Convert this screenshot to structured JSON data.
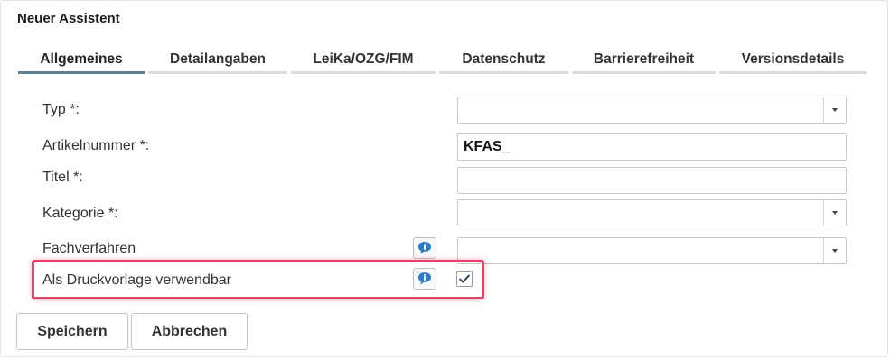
{
  "dialog": {
    "title": "Neuer Assistent"
  },
  "tabs": [
    {
      "label": "Allgemeines",
      "active": true
    },
    {
      "label": "Detailangaben",
      "active": false
    },
    {
      "label": "LeiKa/OZG/FIM",
      "active": false
    },
    {
      "label": "Datenschutz",
      "active": false
    },
    {
      "label": "Barrierefreiheit",
      "active": false
    },
    {
      "label": "Versionsdetails",
      "active": false
    }
  ],
  "form": {
    "typ": {
      "label": "Typ *:",
      "value": ""
    },
    "artikelnummer": {
      "label": "Artikelnummer *:",
      "value": "KFAS_"
    },
    "titel": {
      "label": "Titel *:",
      "value": ""
    },
    "kategorie": {
      "label": "Kategorie *:",
      "value": ""
    },
    "fachverfahren": {
      "label": "Fachverfahren",
      "value": ""
    },
    "druckvorlage": {
      "label": "Als Druckvorlage verwendbar",
      "checked": true
    }
  },
  "buttons": {
    "save": "Speichern",
    "cancel": "Abbrechen"
  },
  "colors": {
    "highlight": "#e8416a",
    "active_tab": "#5b7f93",
    "info_icon": "#2f78c4"
  }
}
